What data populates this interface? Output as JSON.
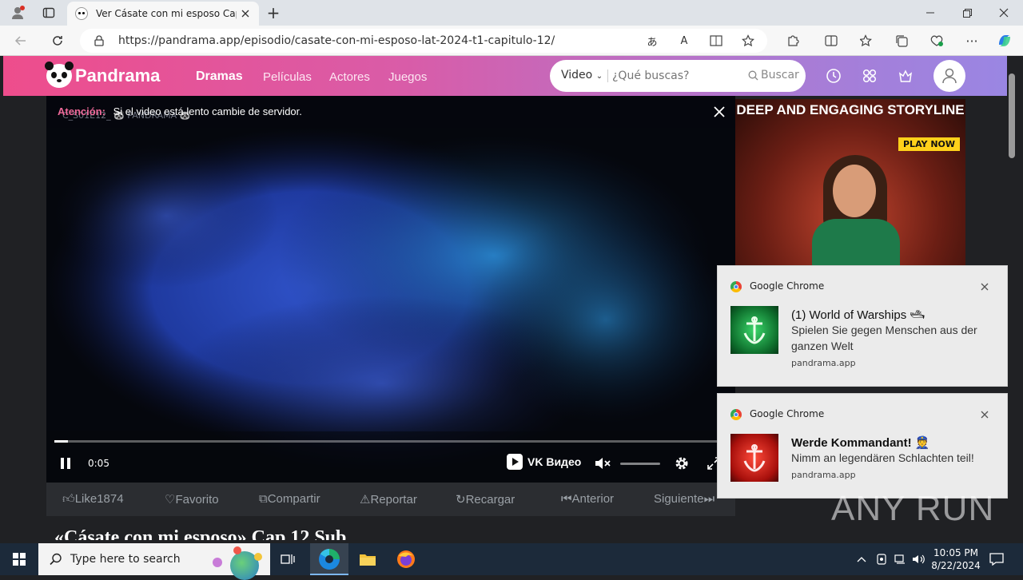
{
  "browser": {
    "tab_title": "Ver Cásate con mi esposo Capítulo",
    "url": "https://pandrama.app/episodio/casate-con-mi-esposo-lat-2024-t1-capitulo-12/",
    "new_tab": "+"
  },
  "site": {
    "logo": "Pandrama",
    "nav": [
      "Dramas",
      "Películas",
      "Actores",
      "Juegos"
    ],
    "search_type": "Video",
    "search_placeholder": "¿Qué buscas?",
    "search_button": "Buscar"
  },
  "player": {
    "notice_label": "Atención:",
    "notice_text": "Si el video está lento cambie de servidor.",
    "watermark": "C_S01E12_ 🐼 PANDRAMA 🐼",
    "time": "0:05",
    "progress": 0.02,
    "brand": "VK Видео"
  },
  "actions": {
    "like": "Like1874",
    "favorite": "Favorito",
    "share": "Compartir",
    "report": "Reportar",
    "reload": "Recargar",
    "previous": "Anterior",
    "next": "Siguiente"
  },
  "ad": {
    "headline": "DEEP AND ENGAGING STORYLINE",
    "cta": "PLAY NOW"
  },
  "notifications": [
    {
      "app": "Google Chrome",
      "title": "(1) World of Warships 🛥",
      "body": "Spielen Sie gegen Menschen aus der ganzen Welt",
      "source": "pandrama.app"
    },
    {
      "app": "Google Chrome",
      "title": "Werde Kommandant! 👮",
      "body": "Nimm an legendären Schlachten teil!",
      "source": "pandrama.app"
    }
  ],
  "taskbar": {
    "search_placeholder": "Type here to search",
    "time": "10:05 PM",
    "date": "8/22/2024"
  },
  "watermark": "ANY RUN",
  "page_title_partial": "«Cásate con mi esposo» Cap 12 Sub"
}
